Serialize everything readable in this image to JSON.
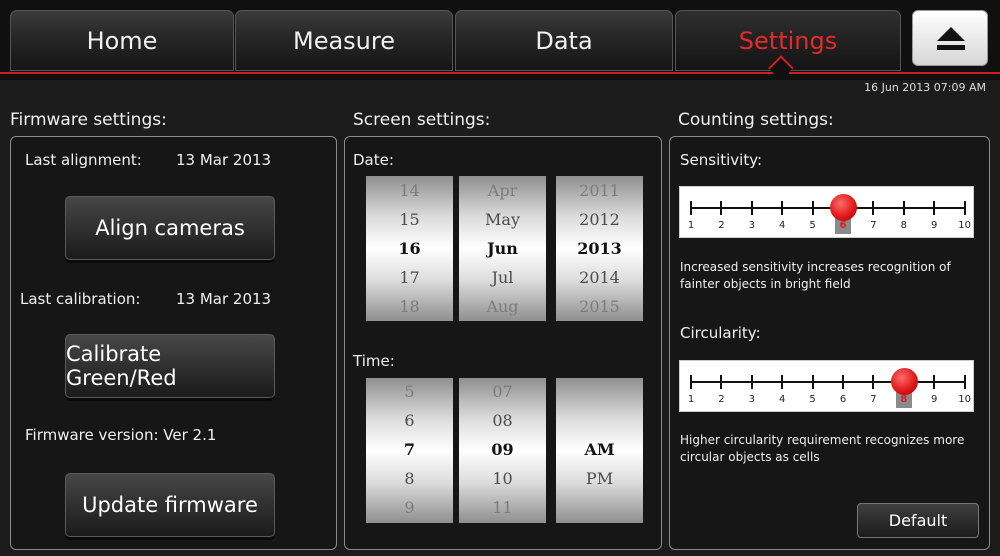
{
  "nav": {
    "tabs": [
      {
        "label": "Home"
      },
      {
        "label": "Measure"
      },
      {
        "label": "Data"
      },
      {
        "label": "Settings",
        "active": true
      }
    ],
    "eject_icon": "eject-icon",
    "datetime": "16 Jun 2013  07:09 AM"
  },
  "colors": {
    "accent": "#e62a2a",
    "background": "#1c1c1c"
  },
  "firmware": {
    "title": "Firmware settings:",
    "last_alignment_label": "Last alignment:",
    "last_alignment_value": "13 Mar 2013",
    "align_button": "Align cameras",
    "last_calibration_label": "Last calibration:",
    "last_calibration_value": "13 Mar 2013",
    "calibrate_button": "Calibrate Green/Red",
    "version_text": "Firmware version: Ver 2.1",
    "update_button": "Update firmware"
  },
  "screen": {
    "title": "Screen settings:",
    "date_label": "Date:",
    "day_values": [
      "14",
      "15",
      "16",
      "17",
      "18"
    ],
    "month_values": [
      "Apr",
      "May",
      "Jun",
      "Jul",
      "Aug"
    ],
    "year_values": [
      "2011",
      "2012",
      "2013",
      "2014",
      "2015"
    ],
    "time_label": "Time:",
    "hour_values": [
      "5",
      "6",
      "7",
      "8",
      "9"
    ],
    "minute_values": [
      "07",
      "08",
      "09",
      "10",
      "11"
    ],
    "ampm_values": [
      "AM",
      "PM"
    ]
  },
  "counting": {
    "title": "Counting settings:",
    "sensitivity_label": "Sensitivity:",
    "sensitivity_value": 6,
    "sensitivity_scale": [
      "1",
      "2",
      "3",
      "4",
      "5",
      "6",
      "7",
      "8",
      "9",
      "10"
    ],
    "sensitivity_desc": "Increased sensitivity increases recognition of fainter objects in bright field",
    "circularity_label": "Circularity:",
    "circularity_value": 8,
    "circularity_scale": [
      "1",
      "2",
      "3",
      "4",
      "5",
      "6",
      "7",
      "8",
      "9",
      "10"
    ],
    "circularity_desc": "Higher circularity requirement recognizes more circular objects as cells",
    "default_button": "Default"
  }
}
